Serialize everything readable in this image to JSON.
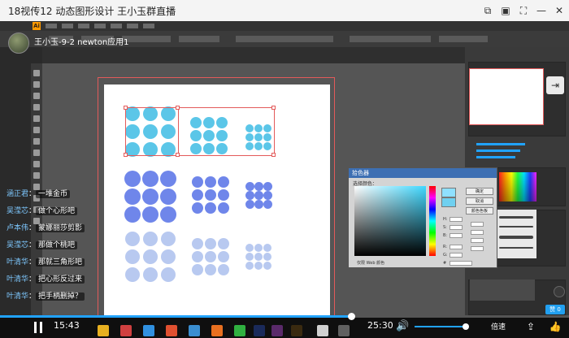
{
  "window": {
    "title": "18视传12  动态图形设计  王小玉群直播"
  },
  "stream": {
    "streamer_name": "王小玉-9-2 newton应用1"
  },
  "illustrator": {
    "color_picker": {
      "title": "拾色器",
      "label": "选择颜色：",
      "ok_label": "确定",
      "cancel_label": "取消",
      "swatches_label": "颜色色板",
      "only_web_colors": "仅限 Web 颜色",
      "hex_prefix": "#"
    }
  },
  "chat": [
    {
      "name": "涵正君",
      "message": "一堆金币"
    },
    {
      "name": "吴滢芯",
      "message": "做个心形吧"
    },
    {
      "name": "卢本伟",
      "message": "蒙娜丽莎剪影"
    },
    {
      "name": "吴滢芯",
      "message": "那做个桃吧"
    },
    {
      "name": "叶清华",
      "message": "那就三角形吧"
    },
    {
      "name": "叶清华",
      "message": "把心形反过来"
    },
    {
      "name": "叶清华",
      "message": "把手柄删掉？"
    }
  ],
  "player": {
    "current_time": "15:43",
    "total_time": "25:30",
    "speed_label": "倍速",
    "progress": 0.617,
    "volume": 0.95,
    "gift_count": "赞 0"
  },
  "colors": {
    "accent": "#21a3ff",
    "chat_name": "#7ec8ff",
    "selection": "#e35a5a",
    "dot_cyan": "#5bc6e8",
    "dot_blue": "#6f86ea",
    "dot_light": "#b8c9f0"
  }
}
